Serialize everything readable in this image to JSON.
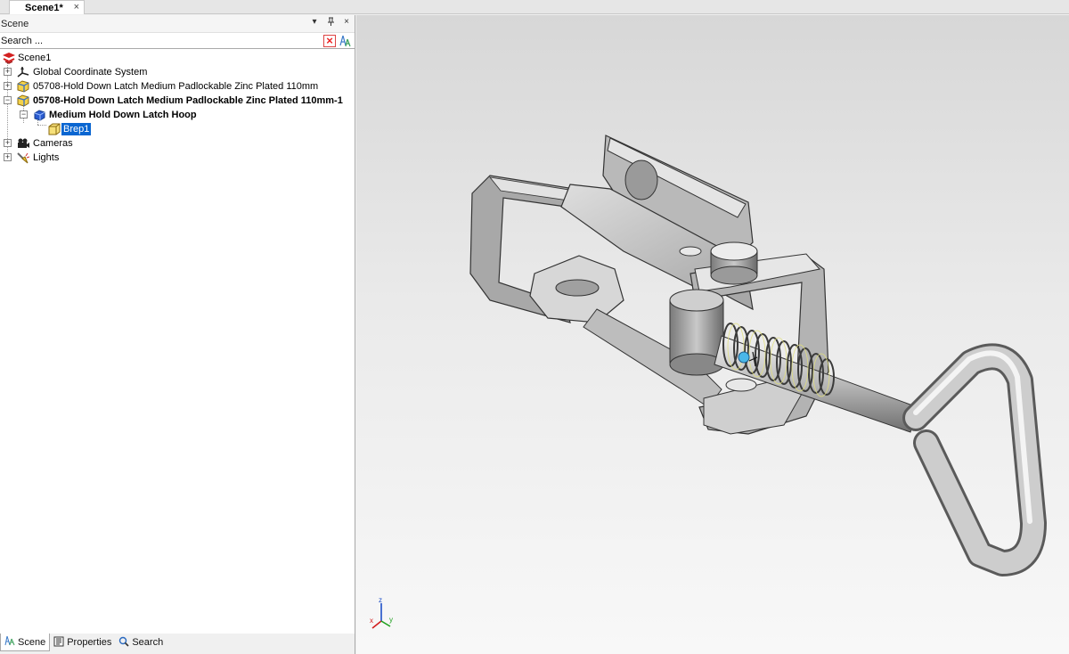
{
  "document_tab": {
    "title": "Scene1*",
    "close": "×"
  },
  "scene_panel": {
    "title": "Scene",
    "buttons": {
      "dropdown": "▾",
      "pin": "⊓",
      "close": "×"
    },
    "search_placeholder": "Search ...",
    "clear_label": "×"
  },
  "tree": {
    "items": [
      {
        "label": "Scene1",
        "icon": "scene-icon"
      },
      {
        "label": "Global Coordinate System",
        "icon": "coordinate-system-icon"
      },
      {
        "label": "05708-Hold Down Latch Medium Padlockable Zinc Plated 110mm",
        "icon": "part-icon"
      },
      {
        "label": "05708-Hold Down Latch Medium Padlockable Zinc Plated 110mm-1",
        "icon": "part-icon"
      },
      {
        "label": "Medium Hold Down Latch Hoop",
        "icon": "body-icon"
      },
      {
        "label": "Brep1",
        "icon": "brep-icon"
      },
      {
        "label": "Cameras",
        "icon": "camera-icon"
      },
      {
        "label": "Lights",
        "icon": "light-icon"
      }
    ]
  },
  "bottom_tabs": [
    {
      "label": "Scene",
      "icon": "scene-tab-icon",
      "active": true
    },
    {
      "label": "Properties",
      "icon": "properties-icon",
      "active": false
    },
    {
      "label": "Search",
      "icon": "magnifier-icon",
      "active": false
    }
  ],
  "axis_labels": {
    "z": "z",
    "x": "x",
    "y": "y"
  },
  "colors": {
    "selection": "#0a66d1",
    "scene_icon": "#d32020",
    "axis_z": "#1e50c8",
    "axis_x": "#d21e1e",
    "axis_y": "#1ea01e"
  }
}
